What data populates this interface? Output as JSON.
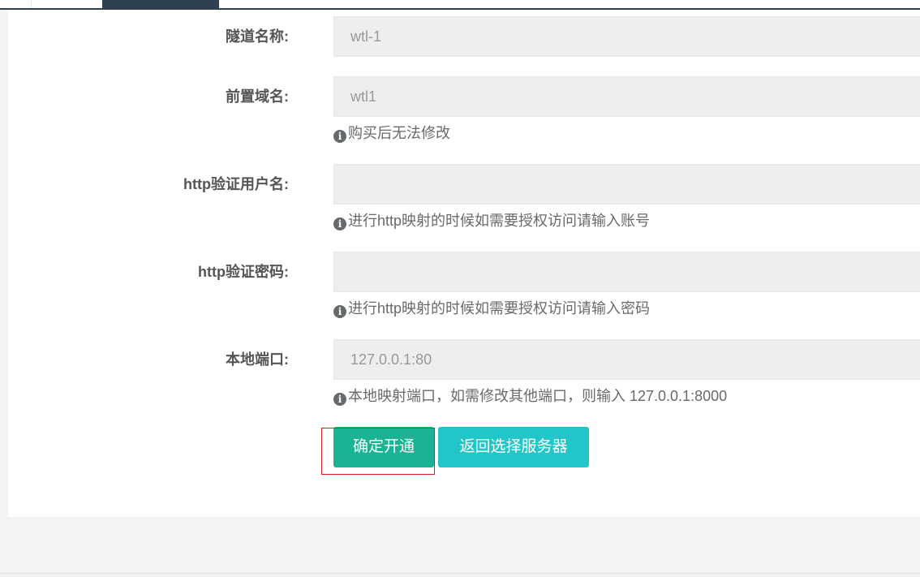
{
  "form": {
    "tunnel_name": {
      "label": "隧道名称:",
      "value": "wtl-1"
    },
    "prefix_domain": {
      "label": "前置域名:",
      "value": "wtl1",
      "hint": "购买后无法修改"
    },
    "http_user": {
      "label": "http验证用户名:",
      "value": "",
      "hint": "进行http映射的时候如需要授权访问请输入账号"
    },
    "http_password": {
      "label": "http验证密码:",
      "value": "",
      "hint": "进行http映射的时候如需要授权访问请输入密码"
    },
    "local_port": {
      "label": "本地端口:",
      "value": "127.0.0.1:80",
      "hint": "本地映射端口，如需修改其他端口，则输入 127.0.0.1:8000"
    }
  },
  "actions": {
    "confirm_label": "确定开通",
    "back_label": "返回选择服务器"
  },
  "icons": {
    "info": "info-circle-icon"
  },
  "colors": {
    "primary": "#1ab394",
    "info": "#23c6c8",
    "nav_dark": "#2f4050",
    "highlight": "#e02020"
  }
}
